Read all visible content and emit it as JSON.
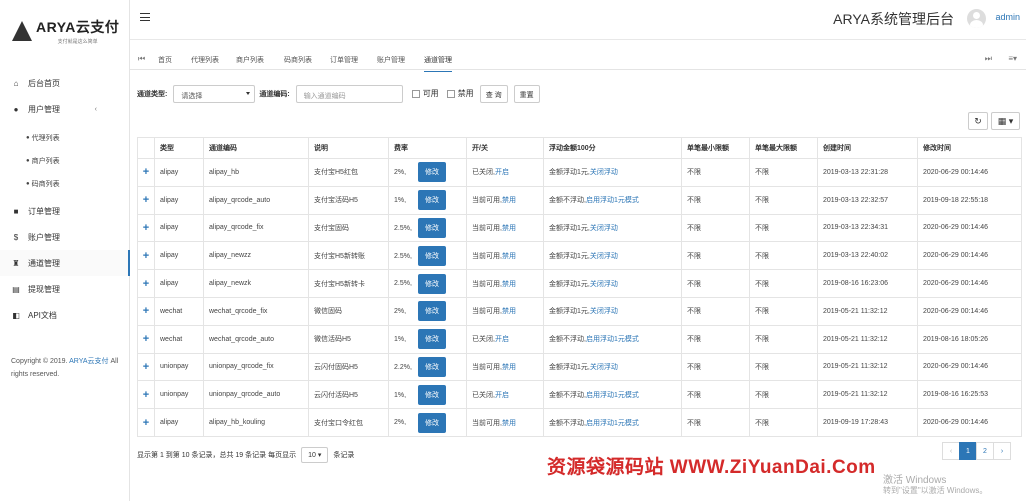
{
  "logo": {
    "main": "ARYA云支付",
    "sub": "支付就是这么简单"
  },
  "sidebar": {
    "items": [
      {
        "icon": "⌂",
        "label": "后台首页"
      },
      {
        "icon": "●",
        "label": "用户管理",
        "chevron": "‹"
      },
      {
        "icon": "■",
        "label": "订单管理"
      },
      {
        "icon": "$",
        "label": "账户管理"
      },
      {
        "icon": "♜",
        "label": "通道管理"
      },
      {
        "icon": "▤",
        "label": "提现管理"
      },
      {
        "icon": "◧",
        "label": "API文档"
      }
    ],
    "subitems": [
      {
        "icon": "●",
        "label": "代理列表"
      },
      {
        "icon": "●",
        "label": "商户列表"
      },
      {
        "icon": "●",
        "label": "码商列表"
      }
    ],
    "copyright": "Copyright © 2019.",
    "copyright_link": "ARYA云支付",
    "copyright_tail": "All rights reserved."
  },
  "header": {
    "title": "ARYA系统管理后台",
    "user": "admin"
  },
  "tabs": [
    "首页",
    "代理列表",
    "商户列表",
    "码商列表",
    "订单管理",
    "账户管理",
    "通道管理"
  ],
  "tab_icons": {
    "left": "⏮",
    "right1": "⏭",
    "right2": "≡▾"
  },
  "filter": {
    "type_label": "通道类型:",
    "type_value": "请选择",
    "code_label": "通道编码:",
    "code_placeholder": "输入通道编码",
    "available": "可用",
    "disabled": "禁用",
    "search": "查 询",
    "reset": "重置"
  },
  "toolbar": {
    "refresh": "↻",
    "columns": "▦ ▾"
  },
  "table": {
    "headers": [
      "",
      "类型",
      "通道编码",
      "说明",
      "费率",
      "开/关",
      "浮动金额100分",
      "单笔最小限额",
      "单笔最大限额",
      "创建时间",
      "修改时间"
    ],
    "edit_label": "修改",
    "expand": "+",
    "rows": [
      {
        "type": "alipay",
        "code": "alipay_hb",
        "desc": "支付宝H5红包",
        "rate": "2%,",
        "status": "已关闭,",
        "action": "开启",
        "float": "金额浮动1元,",
        "float_action": "关闭浮动",
        "min": "不限",
        "max": "不限",
        "created": "2019-03-13 22:31:28",
        "modified": "2020-06-29 00:14:46"
      },
      {
        "type": "alipay",
        "code": "alipay_qrcode_auto",
        "desc": "支付宝活码H5",
        "rate": "1%,",
        "status": "当前可用,",
        "action": "禁用",
        "float": "金额不浮动,",
        "float_action": "启用浮动1元模式",
        "min": "不限",
        "max": "不限",
        "created": "2019-03-13 22:32:57",
        "modified": "2019-09-18 22:55:18"
      },
      {
        "type": "alipay",
        "code": "alipay_qrcode_fix",
        "desc": "支付宝固码",
        "rate": "2.5%,",
        "status": "当前可用,",
        "action": "禁用",
        "float": "金额浮动1元,",
        "float_action": "关闭浮动",
        "min": "不限",
        "max": "不限",
        "created": "2019-03-13 22:34:31",
        "modified": "2020-06-29 00:14:46"
      },
      {
        "type": "alipay",
        "code": "alipay_newzz",
        "desc": "支付宝H5新转账",
        "rate": "2.5%,",
        "status": "当前可用,",
        "action": "禁用",
        "float": "金额浮动1元,",
        "float_action": "关闭浮动",
        "min": "不限",
        "max": "不限",
        "created": "2019-03-13 22:40:02",
        "modified": "2020-06-29 00:14:46"
      },
      {
        "type": "alipay",
        "code": "alipay_newzk",
        "desc": "支付宝H5新转卡",
        "rate": "2.5%,",
        "status": "当前可用,",
        "action": "禁用",
        "float": "金额浮动1元,",
        "float_action": "关闭浮动",
        "min": "不限",
        "max": "不限",
        "created": "2019-08-16 16:23:06",
        "modified": "2020-06-29 00:14:46"
      },
      {
        "type": "wechat",
        "code": "wechat_qrcode_fix",
        "desc": "微信固码",
        "rate": "2%,",
        "status": "当前可用,",
        "action": "禁用",
        "float": "金额浮动1元,",
        "float_action": "关闭浮动",
        "min": "不限",
        "max": "不限",
        "created": "2019-05-21 11:32:12",
        "modified": "2020-06-29 00:14:46"
      },
      {
        "type": "wechat",
        "code": "wechat_qrcode_auto",
        "desc": "微信活码H5",
        "rate": "1%,",
        "status": "已关闭,",
        "action": "开启",
        "float": "金额不浮动,",
        "float_action": "启用浮动1元模式",
        "min": "不限",
        "max": "不限",
        "created": "2019-05-21 11:32:12",
        "modified": "2019-08-16 18:05:26"
      },
      {
        "type": "unionpay",
        "code": "unionpay_qrcode_fix",
        "desc": "云闪付固码H5",
        "rate": "2.2%,",
        "status": "当前可用,",
        "action": "禁用",
        "float": "金额浮动1元,",
        "float_action": "关闭浮动",
        "min": "不限",
        "max": "不限",
        "created": "2019-05-21 11:32:12",
        "modified": "2020-06-29 00:14:46"
      },
      {
        "type": "unionpay",
        "code": "unionpay_qrcode_auto",
        "desc": "云闪付活码H5",
        "rate": "1%,",
        "status": "已关闭,",
        "action": "开启",
        "float": "金额不浮动,",
        "float_action": "启用浮动1元模式",
        "min": "不限",
        "max": "不限",
        "created": "2019-05-21 11:32:12",
        "modified": "2019-08-16 16:25:53"
      },
      {
        "type": "alipay",
        "code": "alipay_hb_kouling",
        "desc": "支付宝口令红包",
        "rate": "2%,",
        "status": "当前可用,",
        "action": "禁用",
        "float": "金额不浮动,",
        "float_action": "启用浮动1元模式",
        "min": "不限",
        "max": "不限",
        "created": "2019-09-19 17:28:43",
        "modified": "2020-06-29 00:14:46"
      }
    ]
  },
  "footer": {
    "summary": "显示第 1 到第 10 条记录，总共 19 条记录 每页显示",
    "page_size": "10 ▾",
    "suffix": "条记录"
  },
  "pager": {
    "prev": "‹",
    "pages": [
      "1",
      "2"
    ],
    "next": "›"
  },
  "watermark": "资源袋源码站 WWW.ZiYuanDai.Com",
  "windows_notice": {
    "line1": "激活 Windows",
    "line2": "转到\"设置\"以激活 Windows。"
  }
}
